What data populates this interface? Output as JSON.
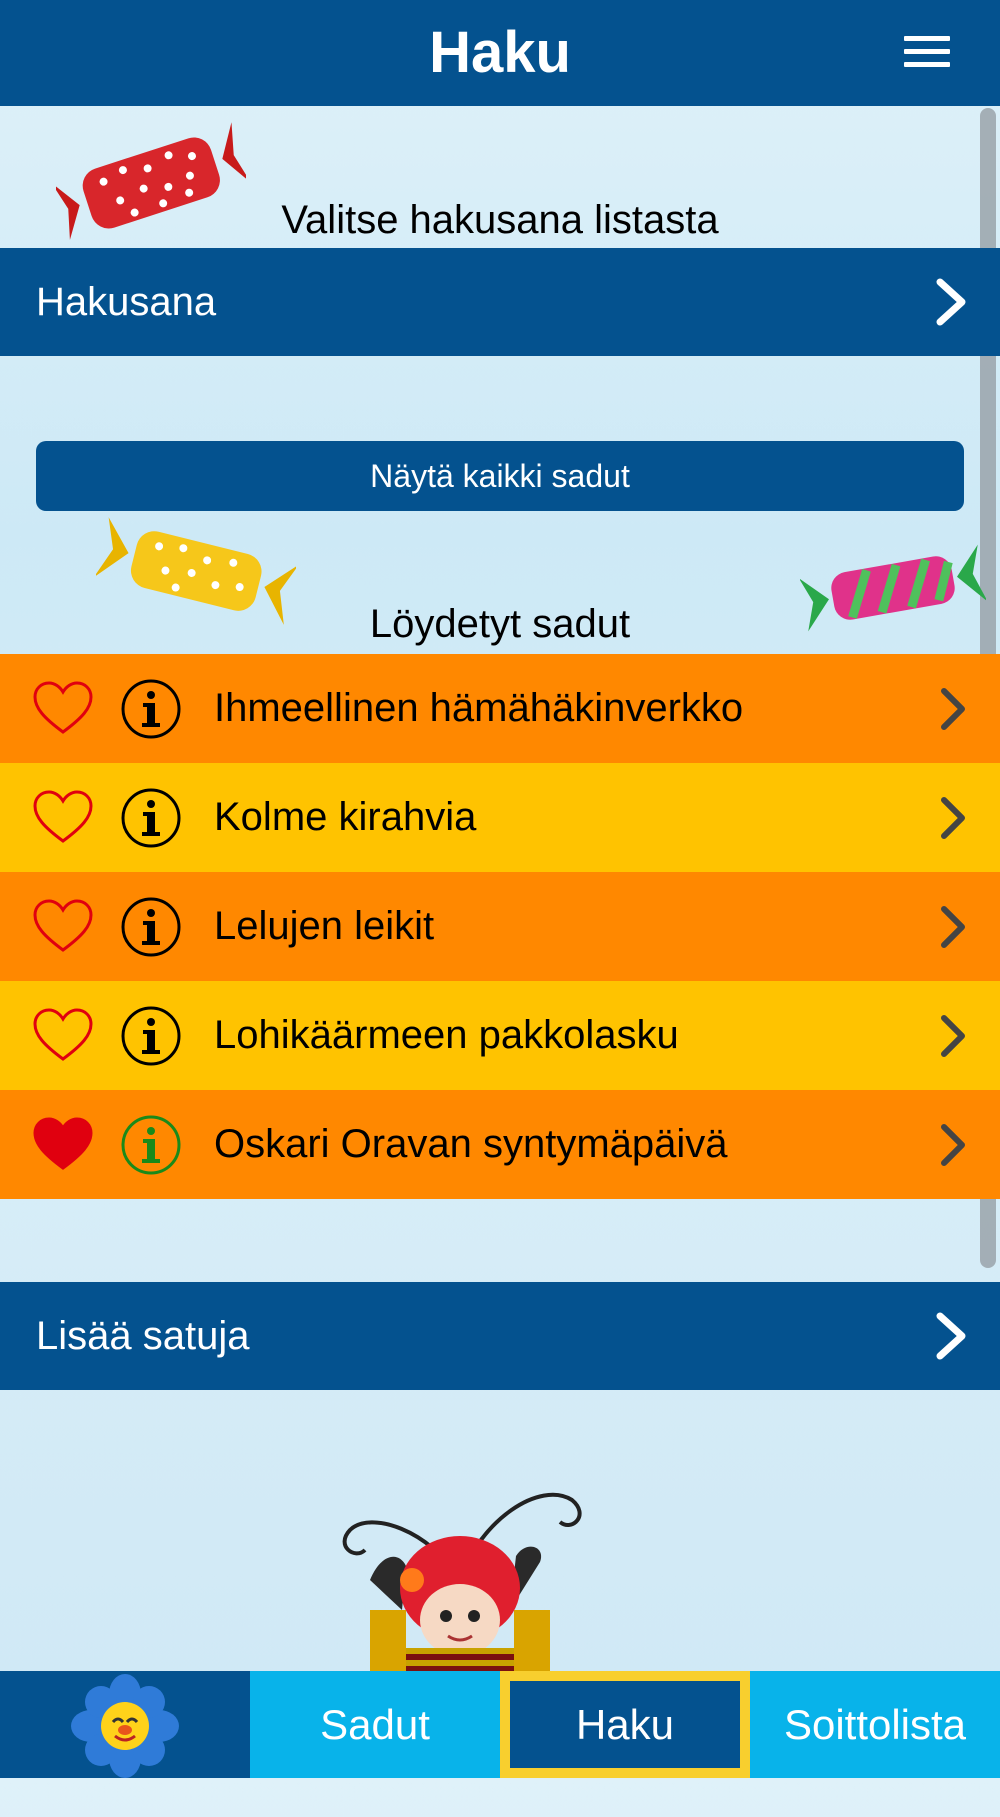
{
  "header": {
    "title": "Haku",
    "menu_icon": "hamburger-menu-icon"
  },
  "search": {
    "instruction": "Valitse hakusana listasta",
    "keyword_label": "Hakusana",
    "show_all_label": "Näytä kaikki sadut"
  },
  "results": {
    "heading": "Löydetyt sadut",
    "items": [
      {
        "title": "Ihmeellinen hämähäkinverkko",
        "favorite": false,
        "info_color": "#000000"
      },
      {
        "title": "Kolme kirahvia",
        "favorite": false,
        "info_color": "#000000"
      },
      {
        "title": "Lelujen leikit",
        "favorite": false,
        "info_color": "#000000"
      },
      {
        "title": "Lohikäärmeen pakkolasku",
        "favorite": false,
        "info_color": "#000000"
      },
      {
        "title": "Oskari Oravan syntymäpäivä",
        "favorite": true,
        "info_color": "#1a8a1a"
      }
    ]
  },
  "more": {
    "label": "Lisää satuja"
  },
  "bottom_nav": {
    "tabs": [
      {
        "label": "",
        "icon": "flower-logo-icon"
      },
      {
        "label": "Sadut"
      },
      {
        "label": "Haku",
        "active": true
      },
      {
        "label": "Soittolista"
      }
    ]
  },
  "colors": {
    "primary": "#04528f",
    "orange_row": "#ff8800",
    "yellow_row": "#ffc300",
    "tab_blue": "#08b3ea",
    "active_border": "#f8cf2e"
  }
}
